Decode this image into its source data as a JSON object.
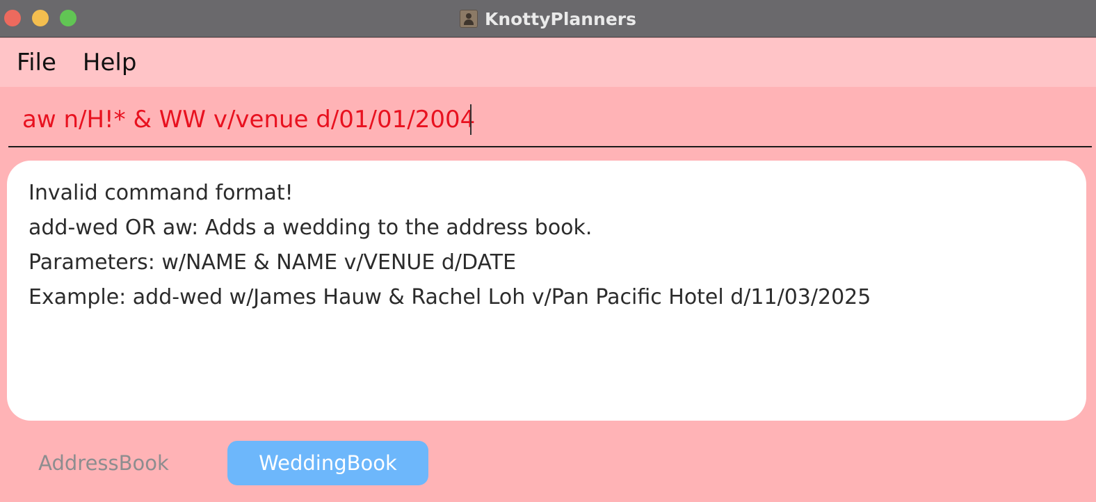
{
  "window": {
    "title": "KnottyPlanners",
    "traffic_lights": {
      "close": "#ed6a5e",
      "minimize": "#f4be4f",
      "maximize": "#61c554"
    }
  },
  "menu": {
    "items": [
      {
        "label": "File"
      },
      {
        "label": "Help"
      }
    ]
  },
  "command": {
    "value": "aw n/H!* & WW v/venue d/01/01/2004",
    "error_color": "#e8111f"
  },
  "result": {
    "lines": [
      "Invalid command format!",
      "add-wed OR aw: Adds a wedding to the address book.",
      "Parameters: w/NAME & NAME v/VENUE d/DATE",
      "Example: add-wed w/James Hauw & Rachel Loh v/Pan Pacific Hotel d/11/03/2025"
    ]
  },
  "tabs": {
    "items": [
      {
        "label": "AddressBook",
        "selected": false
      },
      {
        "label": "WeddingBook",
        "selected": true
      }
    ],
    "selected_color": "#6db7fb"
  },
  "colors": {
    "background": "#ffb3b6",
    "menubar": "#ffc4c7",
    "titlebar": "#6a696c"
  }
}
